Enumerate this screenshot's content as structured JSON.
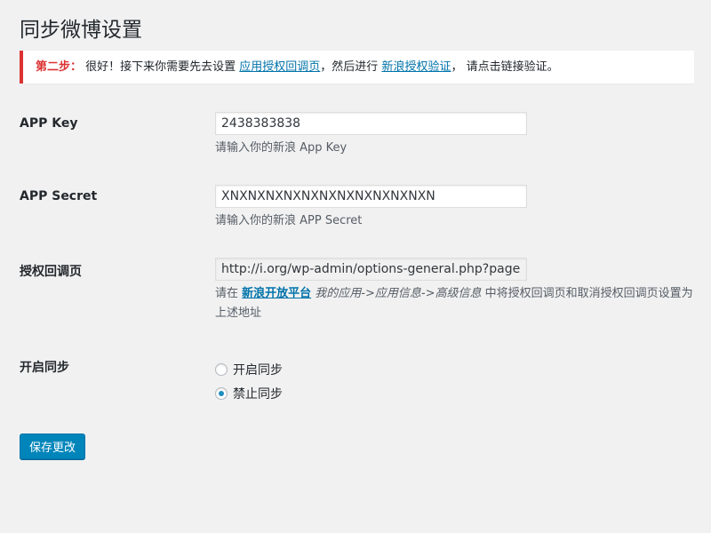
{
  "page": {
    "title": "同步微博设置"
  },
  "notice": {
    "step_label": "第二步：",
    "text_before": " 很好！接下来你需要先去设置 ",
    "link1": "应用授权回调页",
    "text_middle": "，然后进行 ",
    "link2": "新浪授权验证",
    "text_after": "， 请点击链接验证。",
    "accent_color": "#dc3232"
  },
  "fields": {
    "app_key": {
      "label": "APP Key",
      "value": "2438383838",
      "description": "请输入你的新浪 App Key"
    },
    "app_secret": {
      "label": "APP Secret",
      "value": "XNXNXNXNXNXNXNXNXNXNXNXN",
      "description": "请输入你的新浪 APP Secret"
    },
    "callback": {
      "label": "授权回调页",
      "value": "http://i.org/wp-admin/options-general.php?page=wp",
      "desc_prefix": "请在 ",
      "desc_link": "新浪开放平台",
      "desc_path": " 我的应用->应用信息->高级信息",
      "desc_suffix": " 中将授权回调页和取消授权回调页设置为上述地址"
    },
    "sync": {
      "label": "开启同步",
      "options": [
        {
          "label": "开启同步",
          "checked": false
        },
        {
          "label": "禁止同步",
          "checked": true
        }
      ]
    }
  },
  "actions": {
    "save_label": "保存更改",
    "button_color": "#0085ba"
  }
}
